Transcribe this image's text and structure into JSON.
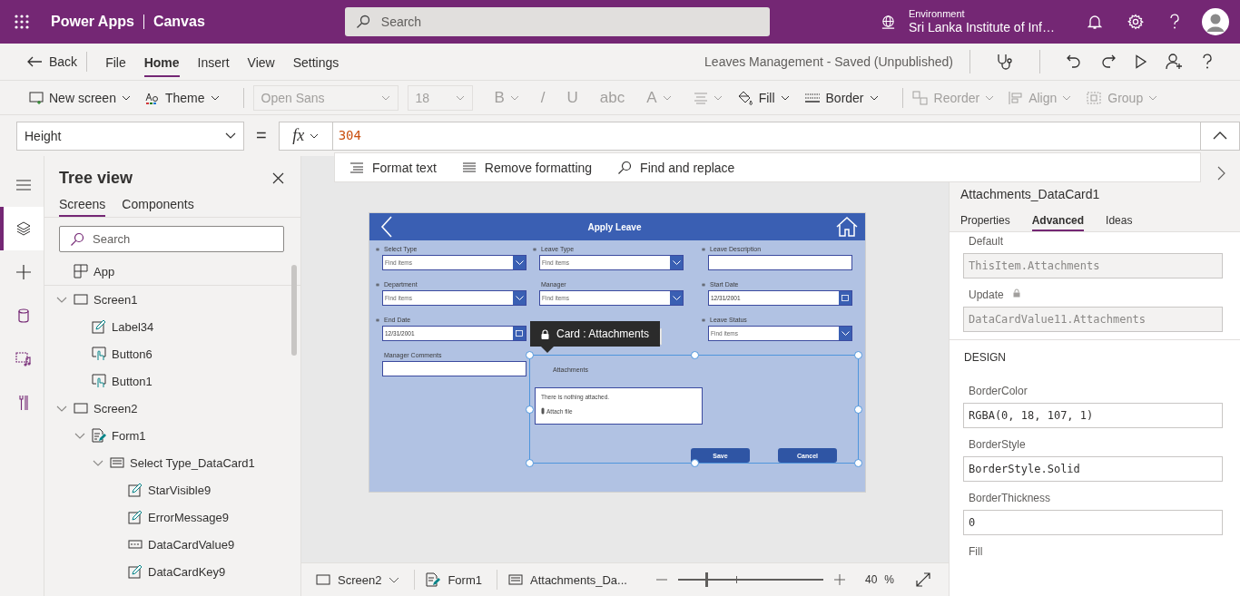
{
  "header": {
    "app_name": "Power Apps",
    "product": "Canvas",
    "search": {
      "placeholder": "Search"
    },
    "environment_label": "Environment",
    "environment_name": "Sri Lanka Institute of Inf…"
  },
  "menu": {
    "back": "Back",
    "tabs": [
      {
        "label": "File",
        "selected": false
      },
      {
        "label": "Home",
        "selected": true
      },
      {
        "label": "Insert",
        "selected": false
      },
      {
        "label": "View",
        "selected": false
      },
      {
        "label": "Settings",
        "selected": false
      }
    ],
    "document_status": "Leaves Management - Saved (Unpublished)"
  },
  "ribbon": {
    "groups": [
      [
        {
          "kind": "newscreen",
          "label": "New screen",
          "disabled": false,
          "dropdown": true
        },
        {
          "kind": "theme",
          "label": "Theme",
          "disabled": false,
          "dropdown": true
        }
      ],
      [
        {
          "kind": "fontfamily",
          "label": "Open Sans",
          "disabled": true,
          "dropdown": true
        },
        {
          "kind": "fontsize",
          "label": "18",
          "disabled": true,
          "dropdown": true
        },
        {
          "kind": "glyph",
          "label": "B",
          "disabled": true,
          "dropdown": true
        },
        {
          "kind": "glyph",
          "label": "/",
          "disabled": true,
          "dropdown": false
        },
        {
          "kind": "glyph",
          "label": "U",
          "disabled": true,
          "dropdown": false
        },
        {
          "kind": "glyph",
          "label": "abc",
          "disabled": true,
          "dropdown": false
        },
        {
          "kind": "glyph",
          "label": "A",
          "disabled": true,
          "dropdown": true
        },
        {
          "kind": "textalign",
          "disabled": true,
          "dropdown": true
        },
        {
          "kind": "fill",
          "label": "Fill",
          "disabled": false,
          "dropdown": true
        },
        {
          "kind": "border",
          "label": "Border",
          "disabled": false,
          "dropdown": true
        }
      ],
      [
        {
          "kind": "reorder",
          "label": "Reorder",
          "disabled": true,
          "dropdown": true
        },
        {
          "kind": "align",
          "label": "Align",
          "disabled": true,
          "dropdown": true
        },
        {
          "kind": "group",
          "label": "Group",
          "disabled": true,
          "dropdown": true
        }
      ]
    ]
  },
  "formula_bar": {
    "property": "Height",
    "equals": "=",
    "fx": "fx",
    "value": "304",
    "actions": [
      {
        "kind": "format",
        "label": "Format text"
      },
      {
        "kind": "clear",
        "label": "Remove formatting"
      },
      {
        "kind": "find",
        "label": "Find and replace"
      }
    ]
  },
  "rail": [
    {
      "kind": "menu",
      "selected": false
    },
    {
      "kind": "tree",
      "selected": true
    },
    {
      "kind": "insert",
      "selected": false
    },
    {
      "kind": "data",
      "selected": false
    },
    {
      "kind": "media",
      "selected": false
    },
    {
      "kind": "tools",
      "selected": false
    }
  ],
  "tree": {
    "title": "Tree view",
    "tabs": [
      {
        "label": "Screens",
        "selected": true
      },
      {
        "label": "Components",
        "selected": false
      }
    ],
    "search": {
      "placeholder": "Search"
    },
    "nodes": [
      {
        "kind": "app",
        "label": "App"
      },
      {
        "kind": "screen",
        "label": "Screen1",
        "expanded": true,
        "children": [
          {
            "kind": "label",
            "label": "Label34"
          },
          {
            "kind": "button",
            "label": "Button6"
          },
          {
            "kind": "button",
            "label": "Button1"
          }
        ]
      },
      {
        "kind": "screen",
        "label": "Screen2",
        "expanded": true,
        "children": [
          {
            "kind": "form",
            "label": "Form1",
            "expanded": true,
            "children": [
              {
                "kind": "card",
                "label": "Select Type_DataCard1",
                "expanded": true,
                "children": [
                  {
                    "kind": "label",
                    "label": "StarVisible9"
                  },
                  {
                    "kind": "label",
                    "label": "ErrorMessage9"
                  },
                  {
                    "kind": "input",
                    "label": "DataCardValue9"
                  },
                  {
                    "kind": "label",
                    "label": "DataCardKey9"
                  }
                ]
              }
            ]
          }
        ]
      }
    ]
  },
  "app_preview": {
    "title": "Apply Leave",
    "columns": [
      [
        {
          "label": "Select Type",
          "required": true,
          "kind": "dropdown",
          "placeholder": "Find items"
        },
        {
          "label": "Department",
          "required": true,
          "kind": "dropdown",
          "placeholder": "Find items"
        },
        {
          "label": "End Date",
          "required": true,
          "kind": "date",
          "value": "12/31/2001"
        },
        {
          "label": "Manager Comments",
          "required": false,
          "kind": "text"
        }
      ],
      [
        {
          "label": "Leave Type",
          "required": true,
          "kind": "dropdown",
          "placeholder": "Find items"
        },
        {
          "label": "Manager",
          "required": false,
          "kind": "dropdown",
          "placeholder": "Find items"
        },
        {
          "kind": "covered"
        }
      ],
      [
        {
          "label": "Leave Description",
          "required": true,
          "kind": "text"
        },
        {
          "label": "Start Date",
          "required": true,
          "kind": "date",
          "value": "12/31/2001"
        },
        {
          "label": "Leave Status",
          "required": true,
          "kind": "dropdown",
          "placeholder": "Find items"
        }
      ]
    ],
    "tooltip": "Card : Attachments",
    "attachments": {
      "label": "Attachments",
      "empty_text": "There is nothing attached.",
      "attach": "Attach file"
    },
    "buttons": [
      "Save",
      "Cancel"
    ]
  },
  "properties_panel": {
    "control": "Attachments_DataCard1",
    "tabs": [
      {
        "label": "Properties",
        "selected": false
      },
      {
        "label": "Advanced",
        "selected": true
      },
      {
        "label": "Ideas",
        "selected": false
      }
    ],
    "data_properties": [
      {
        "label": "Default",
        "value": "ThisItem.Attachments",
        "disabled": true,
        "locked": false
      },
      {
        "label": "Update",
        "value": "DataCardValue11.Attachments",
        "disabled": true,
        "locked": true
      }
    ],
    "section": "DESIGN",
    "design_properties": [
      {
        "label": "BorderColor",
        "value": "RGBA(0, 18, 107, 1)"
      },
      {
        "label": "BorderStyle",
        "value": "BorderStyle.Solid"
      },
      {
        "label": "BorderThickness",
        "value": "0"
      },
      {
        "label": "Fill"
      }
    ]
  },
  "status_bar": {
    "breadcrumbs": [
      {
        "kind": "screen",
        "label": "Screen2",
        "dropdown": true
      },
      {
        "kind": "form",
        "label": "Form1",
        "dropdown": false
      },
      {
        "kind": "card",
        "label": "Attachments_Da...",
        "dropdown": false
      }
    ],
    "zoom": {
      "level": 0.19,
      "value": "40",
      "unit": "%"
    }
  }
}
